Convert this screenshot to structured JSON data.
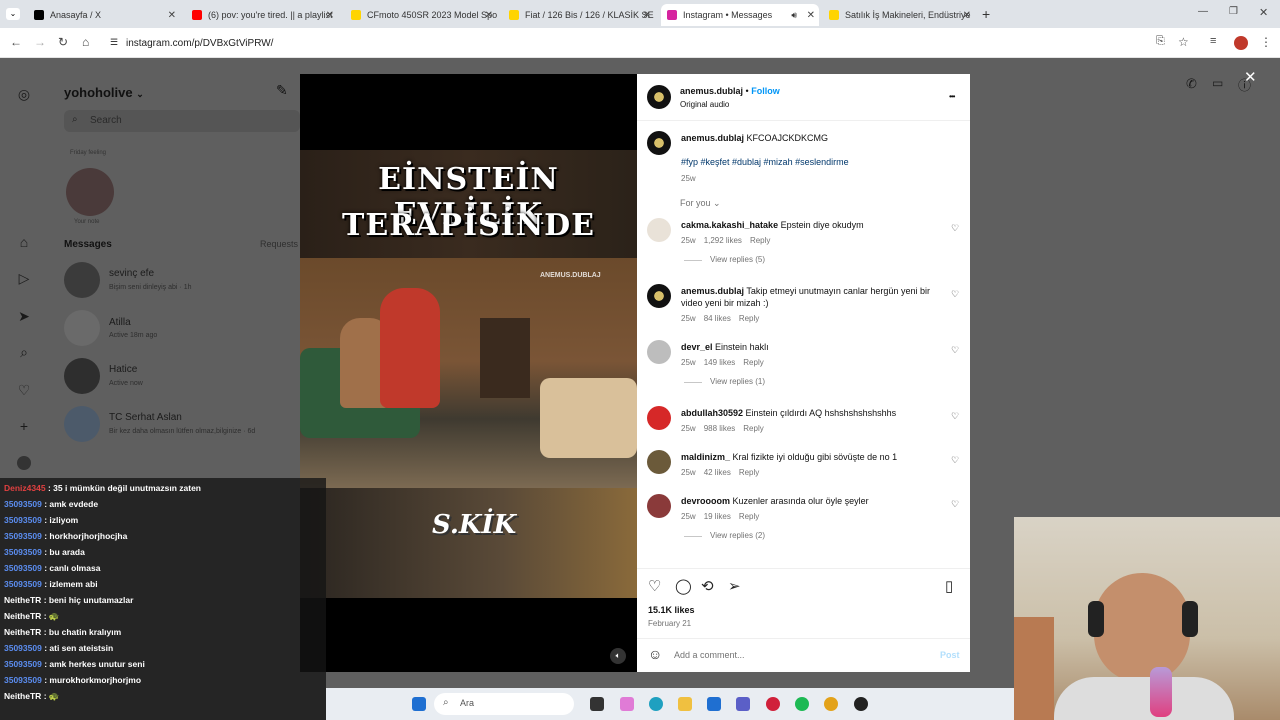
{
  "browser": {
    "tabs": [
      {
        "label": "Anasayfa / X",
        "color": "#000000"
      },
      {
        "label": "(6) pov: you're tired. || a playlist",
        "color": "#ff0000"
      },
      {
        "label": "CFmoto 450SR 2023 Model Spo",
        "color": "#ffd400"
      },
      {
        "label": "Fiat / 126 Bis / 126 / KLASİK SE",
        "color": "#ffd400"
      },
      {
        "label": "Instagram • Messages",
        "color": "#d6249f"
      },
      {
        "label": "Satılık İş Makineleri, Endüstriye",
        "color": "#ffd400"
      }
    ],
    "url": "instagram.com/p/DVBxGtViPRW/"
  },
  "instagram_bg": {
    "username": "yohoholive",
    "search_placeholder": "Search",
    "note_bubble": "Friday feeling",
    "note_label": "Your note",
    "messages_heading": "Messages",
    "requests_label": "Requests",
    "conversations": [
      {
        "name": "sevinç efe",
        "sub": "Bişim seni dinleyiş abi · 1h"
      },
      {
        "name": "Atilla",
        "sub": "Active 18m ago"
      },
      {
        "name": "Hatice",
        "sub": "Active now"
      },
      {
        "name": "TC Serhat Aslan",
        "sub": "Bir kez daha olmasın lütfen olmaz,bilginize · 6d"
      }
    ]
  },
  "video": {
    "title_line1": "EİNSTEİN EVLİLİK",
    "title_line2": "TERAPİSİNDE",
    "watermark": "ANEMUS.DUBLAJ",
    "logo_text": "S.KİK"
  },
  "post": {
    "author": "anemus.dublaj",
    "follow_label": "Follow",
    "audio_label": "Original audio",
    "more_label": "•••",
    "caption": "KFCOAJCKDKCMG",
    "hashtags": "#fyp #keşfet #dublaj #mizah #seslendirme",
    "caption_age": "25w",
    "sort_label": "For you",
    "comments": [
      {
        "user": "cakma.kakashi_hatake",
        "text": "Epstein diye okudym",
        "age": "25w",
        "likes": "1,292 likes",
        "reply": "Reply",
        "view_replies": "View replies (5)"
      },
      {
        "user": "anemus.dublaj",
        "text": "Takip etmeyi unutmayın canlar hergün yeni bir video yeni bir mizah :)",
        "age": "25w",
        "likes": "84 likes",
        "reply": "Reply",
        "view_replies": ""
      },
      {
        "user": "devr_el",
        "text": "Einstein haklı",
        "age": "25w",
        "likes": "149 likes",
        "reply": "Reply",
        "view_replies": "View replies (1)"
      },
      {
        "user": "abdullah30592",
        "text": "Einstein çıldırdı AQ hshshshshshshhs",
        "age": "25w",
        "likes": "988 likes",
        "reply": "Reply",
        "view_replies": ""
      },
      {
        "user": "maldinizm_",
        "text": "Kral fizikte iyi olduğu gibi sövüşte de no 1",
        "age": "25w",
        "likes": "42 likes",
        "reply": "Reply",
        "view_replies": ""
      },
      {
        "user": "devroooom",
        "text": "Kuzenler arasında olur öyle şeyler",
        "age": "25w",
        "likes": "19 likes",
        "reply": "Reply",
        "view_replies": "View replies (2)"
      }
    ],
    "likes_count": "15.1K likes",
    "date": "February 21",
    "comment_placeholder": "Add a comment...",
    "post_button": "Post"
  },
  "chat": [
    {
      "user": "Deniz4345",
      "text": ": 35 i mümkün değil unutmazsın zaten",
      "color": "red"
    },
    {
      "user": "35093509",
      "text": ": amk evdede",
      "color": "blue"
    },
    {
      "user": "35093509",
      "text": ": izliyom",
      "color": "blue"
    },
    {
      "user": "35093509",
      "text": ": horkhorjhorjhocjha",
      "color": "blue"
    },
    {
      "user": "35093509",
      "text": ": bu arada",
      "color": "blue"
    },
    {
      "user": "35093509",
      "text": ": canlı olmasa",
      "color": "blue"
    },
    {
      "user": "35093509",
      "text": ": izlemem abi",
      "color": "blue"
    },
    {
      "user": "NeitheTR",
      "text": ": beni hiç unutamazlar",
      "color": "white"
    },
    {
      "user": "NeitheTR",
      "text": ": 🐢",
      "color": "white"
    },
    {
      "user": "NeitheTR",
      "text": ": bu chatin kralıyım",
      "color": "white"
    },
    {
      "user": "35093509",
      "text": ": ati sen ateistsin",
      "color": "blue"
    },
    {
      "user": "35093509",
      "text": ": amk herkes unutur seni",
      "color": "blue"
    },
    {
      "user": "35093509",
      "text": ": murokhorkmorjhorjmo",
      "color": "blue"
    },
    {
      "user": "NeitheTR",
      "text": ": 🐢",
      "color": "white"
    }
  ],
  "taskbar": {
    "search_placeholder": "Ara"
  }
}
